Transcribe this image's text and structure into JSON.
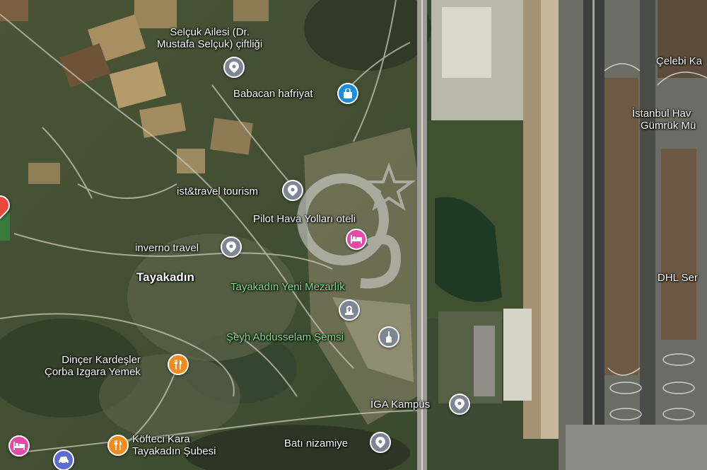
{
  "map": {
    "places": [
      {
        "id": "selcuk",
        "lines": [
          "Selçuk Ailesi (Dr.",
          "Mustafa Selçuk) çiftliği"
        ],
        "icon": "location-icon",
        "color": "gray"
      },
      {
        "id": "babacan",
        "lines": [
          "Babacan hafriyat"
        ],
        "icon": "shopping-bag-icon",
        "color": "blue"
      },
      {
        "id": "isttravel",
        "lines": [
          "ist&travel tourism"
        ],
        "icon": "location-icon",
        "color": "gray"
      },
      {
        "id": "pilot",
        "lines": [
          "Pilot Hava Yolları oteli"
        ],
        "icon": "bed-icon",
        "color": "pink"
      },
      {
        "id": "inverno",
        "lines": [
          "inverno travel"
        ],
        "icon": "location-icon",
        "color": "gray"
      },
      {
        "id": "tayakadin",
        "lines": [
          "Tayakadın"
        ],
        "icon": "",
        "color": ""
      },
      {
        "id": "mezarlik",
        "lines": [
          "Tayakadın Yeni Mezarlık"
        ],
        "icon": "cemetery-icon",
        "color": "gray"
      },
      {
        "id": "seyh",
        "lines": [
          "Şeyh Abdusselam Şemsi"
        ],
        "icon": "mosque-icon",
        "color": "gray"
      },
      {
        "id": "dincer",
        "lines": [
          "Dinçer Kardeşler",
          "Çorba Izgara Yemek"
        ],
        "icon": "restaurant-icon",
        "color": "orange"
      },
      {
        "id": "igakampus",
        "lines": [
          "İGA Kampüs"
        ],
        "icon": "location-icon",
        "color": "gray"
      },
      {
        "id": "kofteci",
        "lines": [
          "Köfteci Kara",
          "Tayakadın Şubesi"
        ],
        "icon": "restaurant-icon",
        "color": "orange"
      },
      {
        "id": "bati",
        "lines": [
          "Batı nizamiye"
        ],
        "icon": "location-icon",
        "color": "gray"
      },
      {
        "id": "celebi",
        "lines": [
          "Çelebi Ka"
        ],
        "icon": "",
        "color": ""
      },
      {
        "id": "istanbulhav",
        "lines": [
          "İstanbul Hav",
          "Gümrük Mü"
        ],
        "icon": "",
        "color": ""
      },
      {
        "id": "dhl",
        "lines": [
          "DHL Ser"
        ],
        "icon": "",
        "color": ""
      }
    ],
    "colors": {
      "gray": "#7d8793",
      "blue": "#1a8de0",
      "pink": "#e24aa6",
      "orange": "#f18a1f",
      "indigo": "#5c6bd6",
      "red": "#e8473d",
      "cemetery_label": "#7fe08a"
    }
  }
}
